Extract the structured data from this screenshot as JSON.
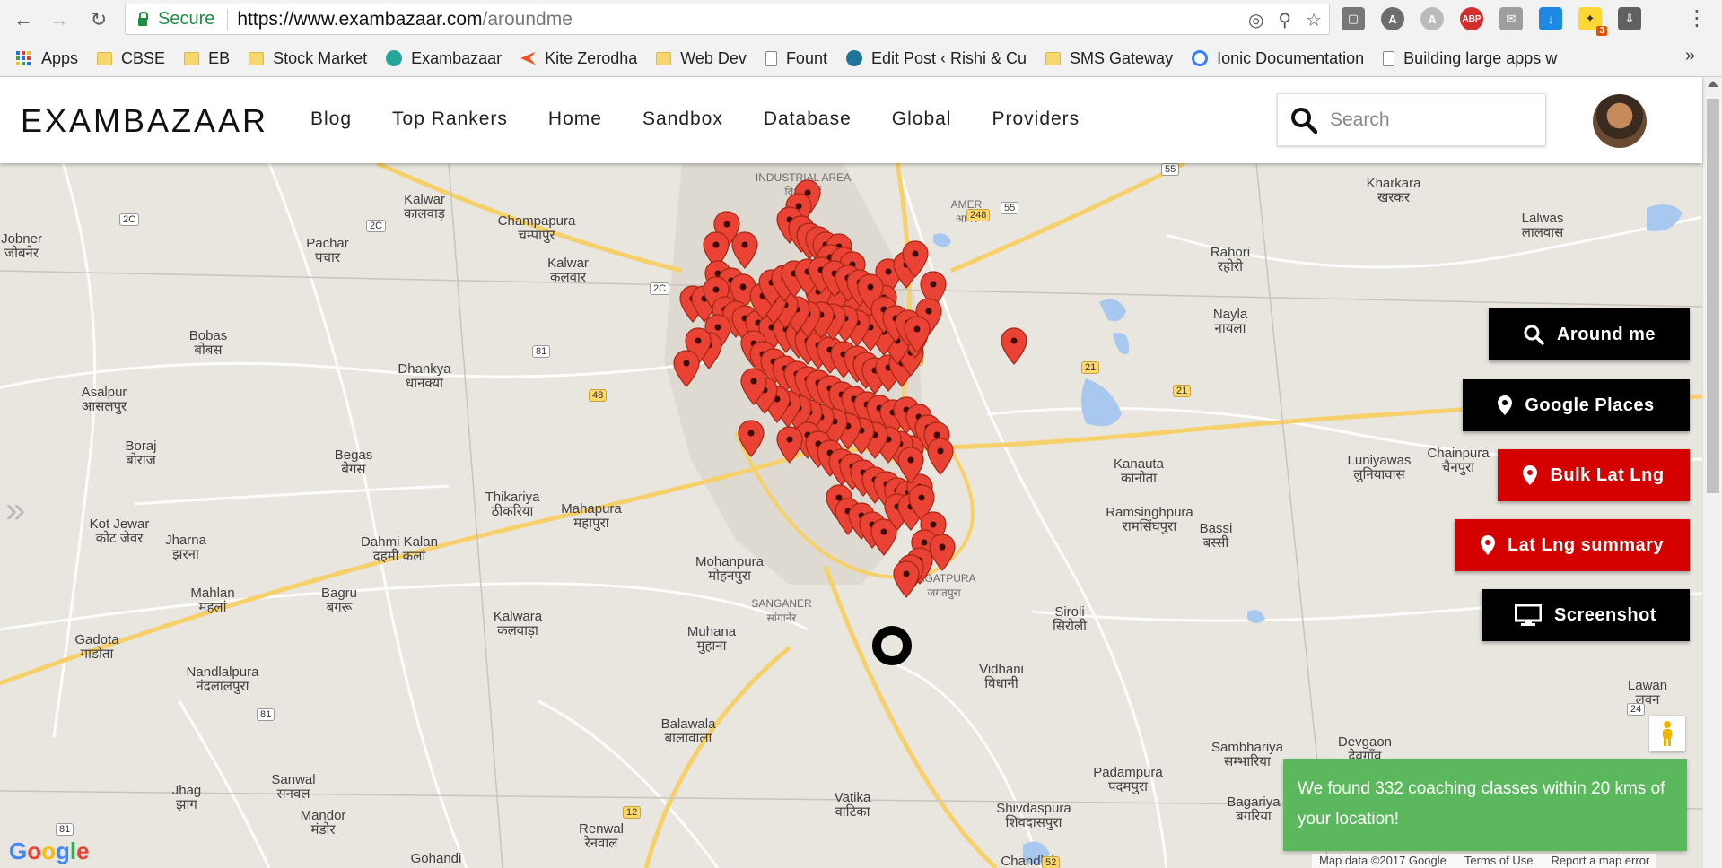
{
  "browser": {
    "secure_label": "Secure",
    "url_host": "https://www.exambazaar.com",
    "url_path": "/aroundme",
    "ext_badge_count": "3",
    "ext_abp": "ABP",
    "bookmarks": [
      "Apps",
      "CBSE",
      "EB",
      "Stock Market",
      "Exambazaar",
      "Kite Zerodha",
      "Web Dev",
      "Fount",
      "Edit Post ‹ Rishi & Cu",
      "SMS Gateway",
      "Ionic Documentation",
      "Building large apps w"
    ],
    "bookmarks_more": "»"
  },
  "header": {
    "brand": "EXAMBAZAAR",
    "nav": [
      "Blog",
      "Top Rankers",
      "Home",
      "Sandbox",
      "Database",
      "Global",
      "Providers"
    ],
    "search_placeholder": "Search"
  },
  "map": {
    "buttons": {
      "around_me": "Around me",
      "google_places": "Google Places",
      "bulk_lat_lng": "Bulk Lat Lng",
      "lat_lng_summary": "Lat Lng summary",
      "screenshot": "Screenshot"
    },
    "toast": "We found 332 coaching classes within 20 kms of your location!",
    "google_logo": "Google",
    "footer": {
      "map_data": "Map data ©2017 Google",
      "terms": "Terms of Use",
      "report": "Report a map error"
    },
    "places": [
      {
        "name": "Kalwar",
        "hi": "कालवाड़"
      },
      {
        "name": "Champapura",
        "hi": "चम्पापुर"
      },
      {
        "name": "Pachar",
        "hi": "पचार"
      },
      {
        "name": "Jobner",
        "hi": "जोबनेर"
      },
      {
        "name": "Kalwar",
        "hi": "कलवार"
      },
      {
        "name": "Bobas",
        "hi": "बोबस"
      },
      {
        "name": "Dhankya",
        "hi": "धानक्या"
      },
      {
        "name": "Asalpur",
        "hi": "आसलपुर"
      },
      {
        "name": "Boraj",
        "hi": "बोराज"
      },
      {
        "name": "Begas",
        "hi": "बेगस"
      },
      {
        "name": "Thikariya",
        "hi": "ठीकरिया"
      },
      {
        "name": "Mahapura",
        "hi": "महापुरा"
      },
      {
        "name": "Kot Jewar",
        "hi": "कोट जेवर"
      },
      {
        "name": "Jharna",
        "hi": "झरना"
      },
      {
        "name": "Dahmi Kalan",
        "hi": "दहमी कलां"
      },
      {
        "name": "Mahlan",
        "hi": "महलां"
      },
      {
        "name": "Bagru",
        "hi": "बगरू"
      },
      {
        "name": "Gadota",
        "hi": "गाडोता"
      },
      {
        "name": "Nandlalpura",
        "hi": "नंदलालपुरा"
      },
      {
        "name": "Kalwara",
        "hi": "कलवाड़ा"
      },
      {
        "name": "Mohanpura",
        "hi": "मोहनपुरा"
      },
      {
        "name": "Muhana",
        "hi": "मुहाना"
      },
      {
        "name": "Balawala",
        "hi": "बालावाला"
      },
      {
        "name": "Sanwal",
        "hi": "सनवल"
      },
      {
        "name": "Jhag",
        "hi": "झाग"
      },
      {
        "name": "Mandor",
        "hi": "मंडोर"
      },
      {
        "name": "Renwal",
        "hi": "रेनवाल"
      },
      {
        "name": "Vatika",
        "hi": "वाटिका"
      },
      {
        "name": "Shivdaspura",
        "hi": "शिवदासपुरा"
      },
      {
        "name": "Padampura",
        "hi": "पदमपुरा"
      },
      {
        "name": "Vidhani",
        "hi": "विधानी"
      },
      {
        "name": "Siroli",
        "hi": "सिरोली"
      },
      {
        "name": "Ramsinghpura",
        "hi": "रामसिंघपुरा"
      },
      {
        "name": "Bassi",
        "hi": "बस्सी"
      },
      {
        "name": "Kanauta",
        "hi": "कानोता"
      },
      {
        "name": "Luniyawas",
        "hi": "लुनियावास"
      },
      {
        "name": "Chainpura",
        "hi": "चैनपुरा"
      },
      {
        "name": "Nayla",
        "hi": "नायला"
      },
      {
        "name": "Rahori",
        "hi": "रहोरी"
      },
      {
        "name": "Kharkara",
        "hi": "खरकर"
      },
      {
        "name": "Lalwas",
        "hi": "लालवास"
      },
      {
        "name": "Sambhariya",
        "hi": "सम्भारिया"
      },
      {
        "name": "Devgaon",
        "hi": "देवगाँव"
      },
      {
        "name": "Bagariya",
        "hi": "बगरिया"
      },
      {
        "name": "Lawan",
        "hi": "लवन"
      },
      {
        "name": "Gohandi",
        "hi": ""
      },
      {
        "name": "Chandlai",
        "hi": ""
      },
      {
        "name": "JAGATPURA",
        "hi": "जगतपुरा"
      },
      {
        "name": "SANGANER",
        "hi": "सांगानेर"
      },
      {
        "name": "AMER",
        "hi": "आमेर"
      },
      {
        "name": "INDUSTRIAL AREA",
        "hi": "विश्वकर्मा"
      }
    ]
  }
}
